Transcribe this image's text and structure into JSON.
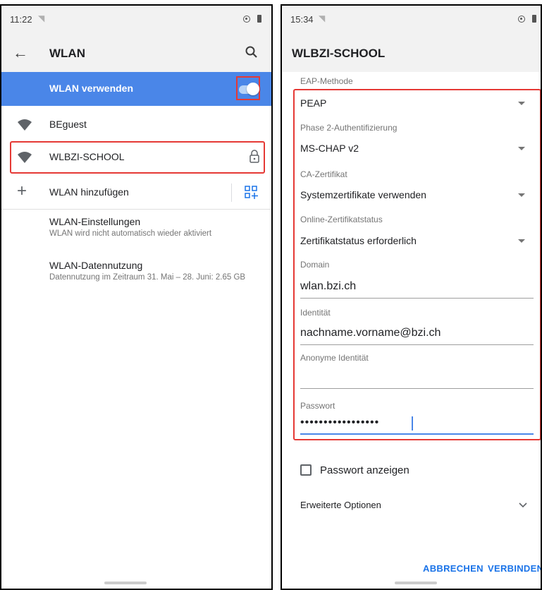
{
  "left_screen": {
    "status": {
      "time": "11:22",
      "wifi_icon": "wifi-status-icon",
      "battery_icon": "battery-icon"
    },
    "header": {
      "back_icon": "arrow-back-icon",
      "title": "WLAN",
      "search_icon": "search-icon"
    },
    "toggle": {
      "label": "WLAN verwenden",
      "state": "on",
      "accent": "#4a86e8"
    },
    "networks": [
      {
        "name": "BEguest",
        "icon": "wifi-icon",
        "secured": false
      },
      {
        "name": "WLBZI-SCHOOL",
        "icon": "wifi-icon",
        "secured": true,
        "highlight": "#e53935"
      }
    ],
    "add_network": {
      "label": "WLAN hinzufügen",
      "icon": "plus-icon",
      "qr_icon": "qr-code-icon"
    },
    "settings": [
      {
        "title": "WLAN-Einstellungen",
        "subtitle": "WLAN wird nicht automatisch wieder aktiviert"
      },
      {
        "title": "WLAN-Datennutzung",
        "subtitle": "Datennutzung im Zeitraum 31. Mai – 28. Juni: 2.65 GB"
      }
    ]
  },
  "right_screen": {
    "status": {
      "time": "15:34"
    },
    "header": {
      "title": "WLBZI-SCHOOL"
    },
    "fields": {
      "eap_method": {
        "label": "EAP-Methode",
        "value": "PEAP"
      },
      "phase2": {
        "label": "Phase 2-Authentifizierung",
        "value": "MS-CHAP v2"
      },
      "ca_cert": {
        "label": "CA-Zertifikat",
        "value": "Systemzertifikate verwenden"
      },
      "online_cert": {
        "label": "Online-Zertifikatstatus",
        "value": "Zertifikatstatus erforderlich"
      },
      "domain": {
        "label": "Domain",
        "value": "wlan.bzi.ch"
      },
      "identity": {
        "label": "Identität",
        "value": "nachname.vorname@bzi.ch"
      },
      "anon_identity": {
        "label": "Anonyme Identität",
        "value": ""
      },
      "password": {
        "label": "Passwort",
        "value": "•••••••••••••••••"
      }
    },
    "show_password": {
      "label": "Passwort anzeigen",
      "checked": false
    },
    "advanced": {
      "label": "Erweiterte Optionen"
    },
    "buttons": {
      "cancel": "ABBRECHEN",
      "connect": "VERBINDEN"
    }
  }
}
